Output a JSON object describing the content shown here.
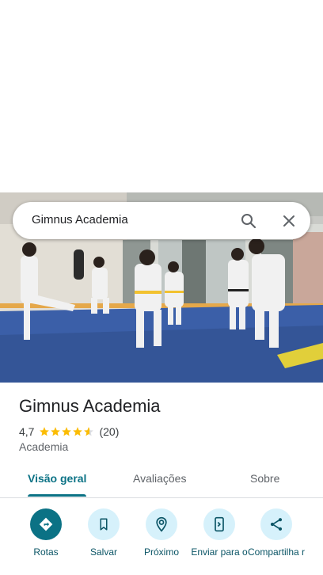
{
  "search": {
    "query": "Gimnus Academia"
  },
  "place": {
    "title": "Gimnus Academia",
    "rating": "4,7",
    "stars": 4.7,
    "review_count": "(20)",
    "category": "Academia"
  },
  "tabs": [
    {
      "label": "Visão geral",
      "active": true
    },
    {
      "label": "Avaliações",
      "active": false
    },
    {
      "label": "Sobre",
      "active": false
    }
  ],
  "actions": [
    {
      "label": "Rotas",
      "icon": "directions-icon"
    },
    {
      "label": "Salvar",
      "icon": "bookmark-icon"
    },
    {
      "label": "Próximo",
      "icon": "nearby-icon"
    },
    {
      "label": "Enviar para o",
      "icon": "send-to-phone-icon"
    },
    {
      "label": "Compartilha r",
      "icon": "share-icon"
    }
  ],
  "colors": {
    "accent": "#0b7285",
    "action_bg": "#d6f1fb",
    "star": "#fbbc04"
  }
}
